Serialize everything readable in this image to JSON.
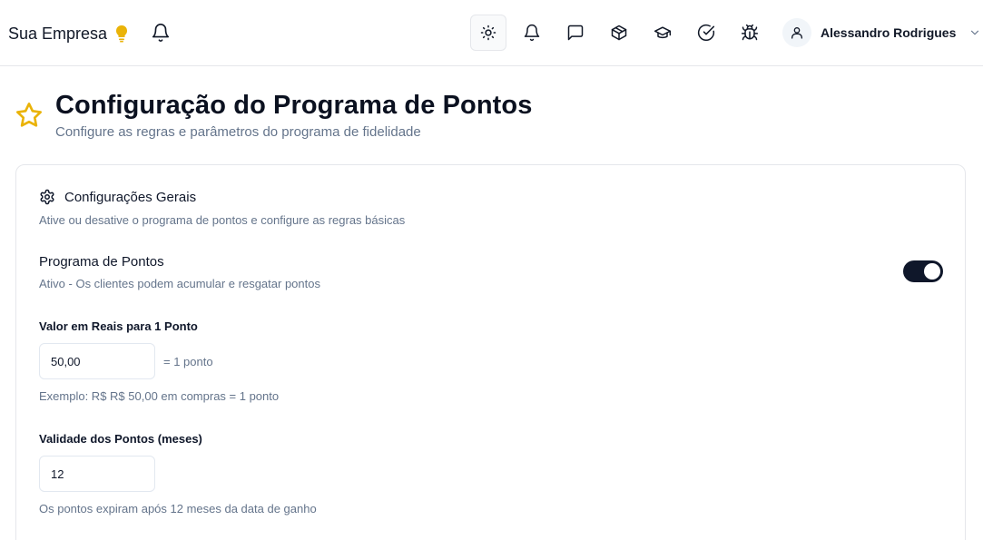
{
  "header": {
    "brand": "Sua Empresa",
    "brand_icon": "lightbulb-icon",
    "icons": [
      "sun-icon",
      "bell-icon",
      "message-icon",
      "package-icon",
      "graduation-cap-icon",
      "check-circle-icon",
      "bug-icon"
    ],
    "user_name": "Alessandro Rodrigues",
    "accent": "#eab308"
  },
  "page": {
    "title": "Configuração do Programa de Pontos",
    "subtitle": "Configure as regras e parâmetros do programa de fidelidade",
    "title_icon": "star-icon"
  },
  "card": {
    "title": "Configurações Gerais",
    "description": "Ative ou desative o programa de pontos e configure as regras básicas",
    "program": {
      "label": "Programa de Pontos",
      "status": "Ativo - Os clientes podem acumular e resgatar pontos",
      "enabled": true
    },
    "value_field": {
      "label": "Valor em Reais para 1 Ponto",
      "value": "50,00",
      "suffix": "= 1 ponto",
      "hint": "Exemplo: R$ R$ 50,00 em compras = 1 ponto"
    },
    "validity_field": {
      "label": "Validade dos Pontos (meses)",
      "value": "12",
      "hint": "Os pontos expiram após 12 meses da data de ganho"
    }
  }
}
